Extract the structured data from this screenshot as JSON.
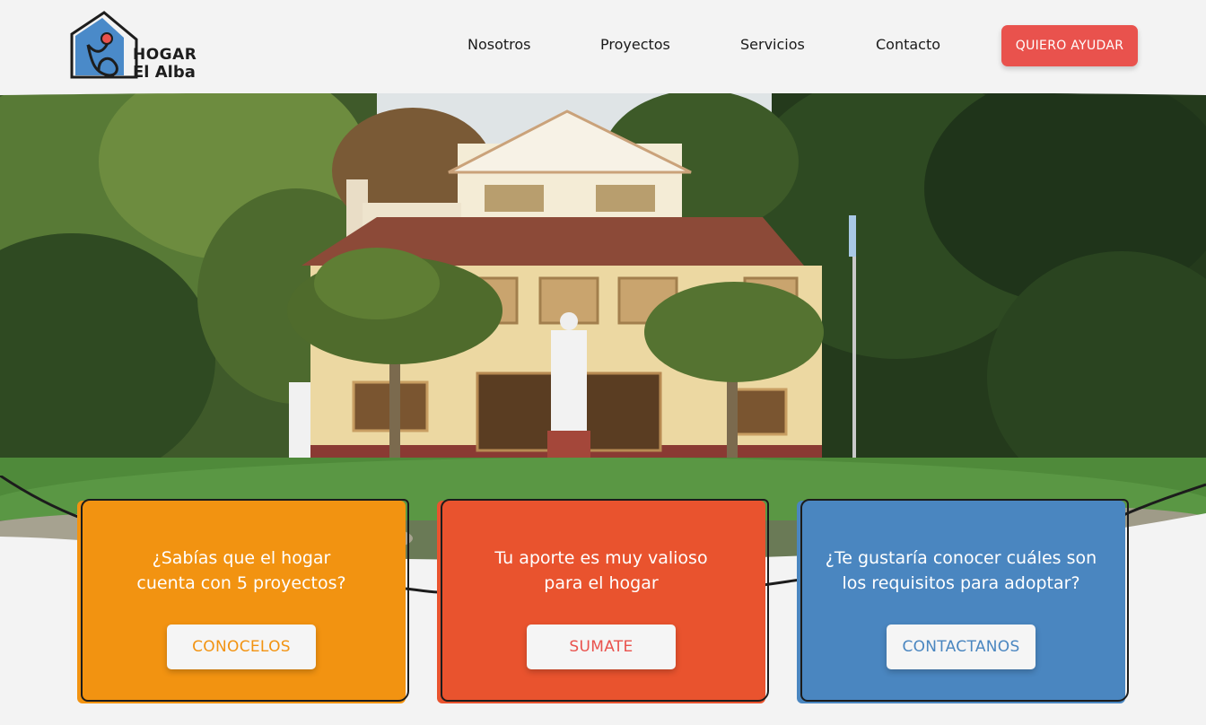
{
  "brand": {
    "line1": "HOGAR",
    "line2": "El Alba",
    "colors": {
      "blue": "#4a8ac9",
      "red": "#e9524d",
      "dark": "#1d1d1d"
    }
  },
  "nav": {
    "items": [
      {
        "label": "Nosotros"
      },
      {
        "label": "Proyectos"
      },
      {
        "label": "Servicios"
      },
      {
        "label": "Contacto"
      }
    ],
    "cta_label": "QUIERO AYUDAR"
  },
  "hero": {
    "image_icon": "house-photo"
  },
  "cards": [
    {
      "text_line1": "¿Sabías que el hogar",
      "text_line2": "cuenta con 5 proyectos?",
      "button_label": "CONOCELOS",
      "color": "#f29311",
      "button_text_color": "#f29311"
    },
    {
      "text_line1": "Tu aporte es muy valioso",
      "text_line2": "para el hogar",
      "button_label": "SUMATE",
      "color": "#e9532e",
      "button_text_color": "#e9524d"
    },
    {
      "text_line1": "¿Te gustaría conocer cuáles son",
      "text_line2": "los requisitos para adoptar?",
      "button_label": "CONTACTANOS",
      "color": "#4a86c0",
      "button_text_color": "#4a86c0"
    }
  ]
}
